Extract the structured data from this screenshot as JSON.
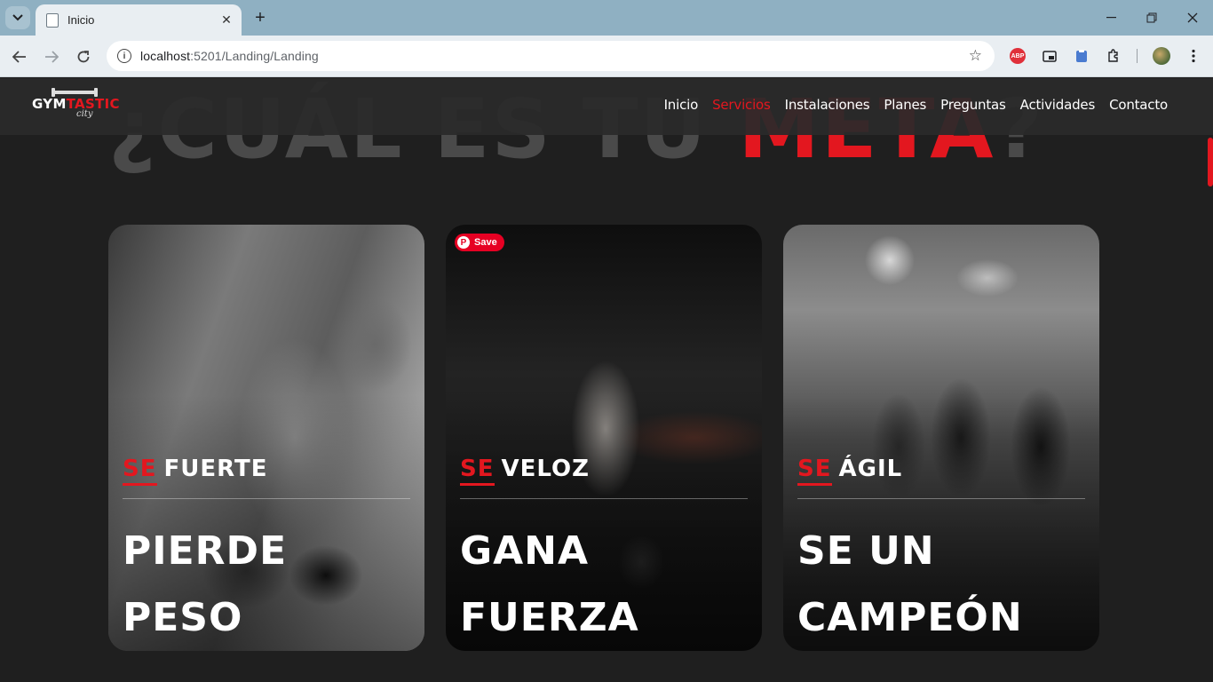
{
  "browser": {
    "tab_title": "Inicio",
    "url_host": "localhost",
    "url_rest": ":5201/Landing/Landing",
    "abp_label": "ABP"
  },
  "site": {
    "logo_text_a": "GYM",
    "logo_text_b": "TASTIC",
    "logo_sub": "city",
    "nav": [
      {
        "label": "Inicio",
        "active": false
      },
      {
        "label": "Servicios",
        "active": true
      },
      {
        "label": "Instalaciones",
        "active": false
      },
      {
        "label": "Planes",
        "active": false
      },
      {
        "label": "Preguntas",
        "active": false
      },
      {
        "label": "Actividades",
        "active": false
      },
      {
        "label": "Contacto",
        "active": false
      }
    ],
    "heading_a": "¿CUÁL ES TU ",
    "heading_b": "META",
    "heading_c": "?",
    "accent_color": "#e3171f"
  },
  "cards": [
    {
      "se": "SE",
      "word": "FUERTE",
      "title_1": "PIERDE",
      "title_2": "PESO"
    },
    {
      "se": "SE",
      "word": "VELOZ",
      "title_1": "GANA",
      "title_2": "FUERZA",
      "pin_label": "Save"
    },
    {
      "se": "SE",
      "word": "ÁGIL",
      "title_1": "SE UN",
      "title_2": "CAMPEÓN"
    }
  ]
}
